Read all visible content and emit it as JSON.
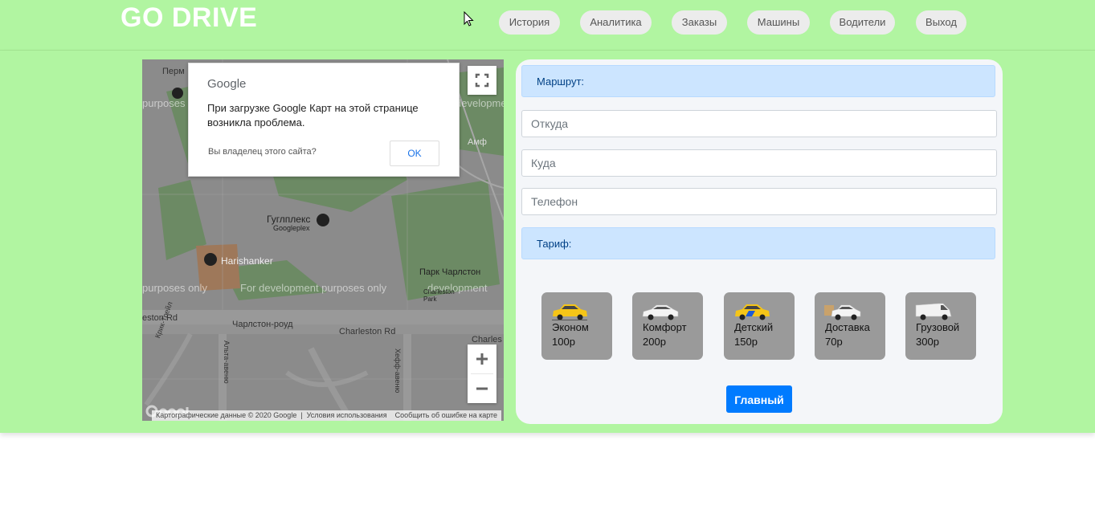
{
  "header": {
    "brand": "GO DRIVE",
    "nav": [
      {
        "label": "История"
      },
      {
        "label": "Аналитика"
      },
      {
        "label": "Заказы"
      },
      {
        "label": "Машины"
      },
      {
        "label": "Водители"
      },
      {
        "label": "Выход"
      }
    ]
  },
  "map": {
    "dialog": {
      "logo": "Google",
      "message": "При загрузке Google Карт на этой странице возникла проблема.",
      "owner_question": "Вы владелец этого сайта?",
      "ok_label": "OK"
    },
    "watermark": "For development purposes only",
    "watermark_left": "purposes only",
    "watermark_right": "development",
    "labels": {
      "perm": "Перм",
      "googleplex_ru": "Гуглплекс",
      "googleplex_en": "Googleplex",
      "harishanker": "Harishanker",
      "park_ru": "Парк Чарлстон",
      "park_en": "Charleston Park",
      "road_ru": "Чарлстон-роуд",
      "road_en": "Charleston Rd",
      "road_left": "eston Rd",
      "charles": "Charles",
      "amf": "Амф",
      "alta": "Альта-авеню",
      "krick": "Крик-Трейл",
      "heff": "Хефф-авеню"
    },
    "footer": {
      "data": "Картографические данные © 2020 Google",
      "terms": "Условия использования",
      "report": "Сообщить об ошибке на карте"
    },
    "controls": {
      "fullscreen": "fullscreen-icon",
      "zoom_in": "plus-icon",
      "zoom_out": "minus-icon"
    }
  },
  "form": {
    "route_label": "Маршрут:",
    "from_placeholder": "Откуда",
    "to_placeholder": "Куда",
    "phone_placeholder": "Телефон",
    "tariff_label": "Тариф:",
    "tariffs": [
      {
        "name": "Эконом",
        "price": "100р",
        "icon": "yellow-taxi-icon"
      },
      {
        "name": "Комфорт",
        "price": "200р",
        "icon": "white-car-icon"
      },
      {
        "name": "Детский",
        "price": "150р",
        "icon": "yellow-blue-taxi-icon"
      },
      {
        "name": "Доставка",
        "price": "70р",
        "icon": "delivery-car-icon"
      },
      {
        "name": "Грузовой",
        "price": "300р",
        "icon": "van-icon"
      }
    ],
    "submit_label": "Главный"
  },
  "colors": {
    "header_bg": "#b1f5a1",
    "info_bar": "#cce5ff",
    "primary_button": "#007bff",
    "tariff_card": "#9a9a9a"
  }
}
